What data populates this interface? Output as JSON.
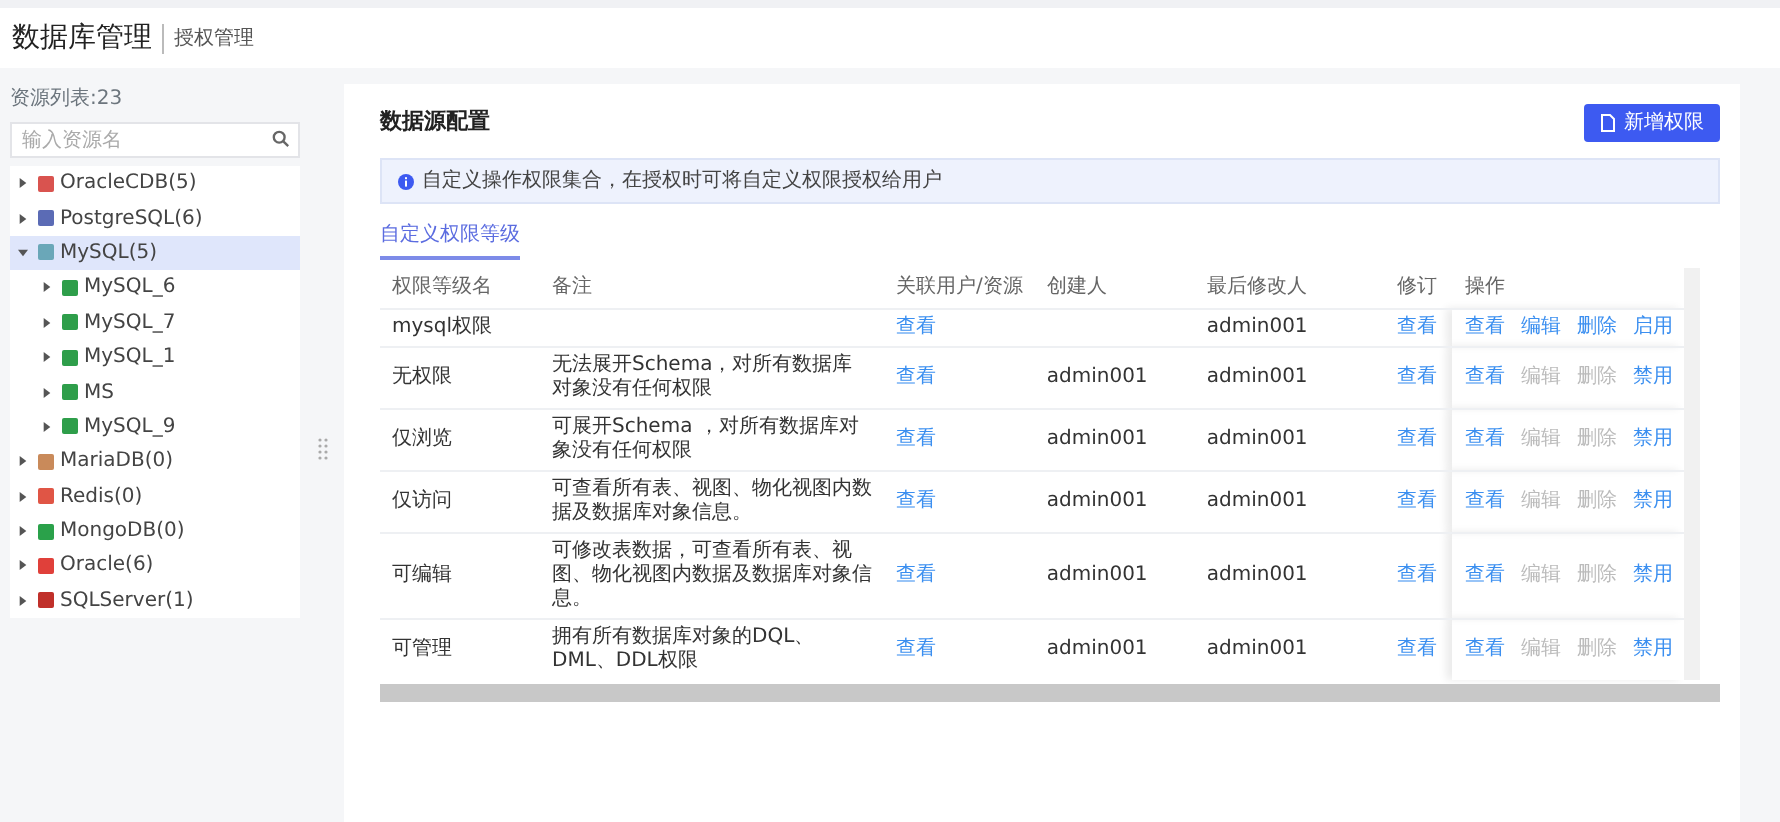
{
  "header": {
    "title": "数据库管理",
    "subtitle": "授权管理"
  },
  "sidebar": {
    "count_label": "资源列表:23",
    "search": {
      "placeholder": "输入资源名"
    },
    "tree": [
      {
        "label": "OracleCDB(5)",
        "color": "#d9534f",
        "expanded": false,
        "selected": false
      },
      {
        "label": "PostgreSQL(6)",
        "color": "#5b6bb5",
        "expanded": false,
        "selected": false
      },
      {
        "label": "MySQL(5)",
        "color": "#6aa7b8",
        "expanded": true,
        "selected": true,
        "children": [
          {
            "label": "MySQL_6",
            "color": "#2e9e4a",
            "expanded": false,
            "selected": false
          },
          {
            "label": "MySQL_7",
            "color": "#2e9e4a",
            "expanded": false,
            "selected": false
          },
          {
            "label": "MySQL_1",
            "color": "#2e9e4a",
            "expanded": false,
            "selected": false
          },
          {
            "label": "MS",
            "color": "#2e9e4a",
            "expanded": false,
            "selected": false
          },
          {
            "label": "MySQL_9",
            "color": "#2e9e4a",
            "expanded": false,
            "selected": false
          }
        ]
      },
      {
        "label": "MariaDB(0)",
        "color": "#c98a5a",
        "expanded": false,
        "selected": false
      },
      {
        "label": "Redis(0)",
        "color": "#e05545",
        "expanded": false,
        "selected": false
      },
      {
        "label": "MongoDB(0)",
        "color": "#2aa14a",
        "expanded": false,
        "selected": false
      },
      {
        "label": "Oracle(6)",
        "color": "#e0403a",
        "expanded": false,
        "selected": false
      },
      {
        "label": "SQLServer(1)",
        "color": "#c0302a",
        "expanded": false,
        "selected": false
      }
    ]
  },
  "panel": {
    "title": "数据源配置",
    "add_button": "新增权限",
    "notice": "自定义操作权限集合，在授权时可将自定义权限授权给用户",
    "tabs": [
      {
        "label": "自定义权限等级",
        "selected": true
      }
    ],
    "table": {
      "columns": [
        "权限等级名",
        "备注",
        "关联用户/资源",
        "创建人",
        "最后修改人",
        "修订",
        "操作"
      ],
      "rows": [
        {
          "name": "mysql权限",
          "note": "",
          "linked": "查看",
          "creator": "",
          "modifier": "admin001",
          "revision": "查看",
          "actions": [
            {
              "label": "查看",
              "disabled": false
            },
            {
              "label": "编辑",
              "disabled": false
            },
            {
              "label": "删除",
              "disabled": false
            },
            {
              "label": "启用",
              "disabled": false
            }
          ]
        },
        {
          "name": "无权限",
          "note": "无法展开Schema，对所有数据库对象没有任何权限",
          "linked": "查看",
          "creator": "admin001",
          "modifier": "admin001",
          "revision": "查看",
          "actions": [
            {
              "label": "查看",
              "disabled": false
            },
            {
              "label": "编辑",
              "disabled": true
            },
            {
              "label": "删除",
              "disabled": true
            },
            {
              "label": "禁用",
              "disabled": false
            }
          ]
        },
        {
          "name": "仅浏览",
          "note": "可展开Schema ，对所有数据库对象没有任何权限",
          "linked": "查看",
          "creator": "admin001",
          "modifier": "admin001",
          "revision": "查看",
          "actions": [
            {
              "label": "查看",
              "disabled": false
            },
            {
              "label": "编辑",
              "disabled": true
            },
            {
              "label": "删除",
              "disabled": true
            },
            {
              "label": "禁用",
              "disabled": false
            }
          ]
        },
        {
          "name": "仅访问",
          "note": "可查看所有表、视图、物化视图内数据及数据库对象信息。",
          "linked": "查看",
          "creator": "admin001",
          "modifier": "admin001",
          "revision": "查看",
          "actions": [
            {
              "label": "查看",
              "disabled": false
            },
            {
              "label": "编辑",
              "disabled": true
            },
            {
              "label": "删除",
              "disabled": true
            },
            {
              "label": "禁用",
              "disabled": false
            }
          ]
        },
        {
          "name": "可编辑",
          "note": "可修改表数据，可查看所有表、视图、物化视图内数据及数据库对象信息。",
          "linked": "查看",
          "creator": "admin001",
          "modifier": "admin001",
          "revision": "查看",
          "actions": [
            {
              "label": "查看",
              "disabled": false
            },
            {
              "label": "编辑",
              "disabled": true
            },
            {
              "label": "删除",
              "disabled": true
            },
            {
              "label": "禁用",
              "disabled": false
            }
          ]
        },
        {
          "name": "可管理",
          "note": "拥有所有数据库对象的DQL、DML、DDL权限",
          "linked": "查看",
          "creator": "admin001",
          "modifier": "admin001",
          "revision": "查看",
          "actions": [
            {
              "label": "查看",
              "disabled": false
            },
            {
              "label": "编辑",
              "disabled": true
            },
            {
              "label": "删除",
              "disabled": true
            },
            {
              "label": "禁用",
              "disabled": false
            }
          ]
        }
      ]
    }
  }
}
